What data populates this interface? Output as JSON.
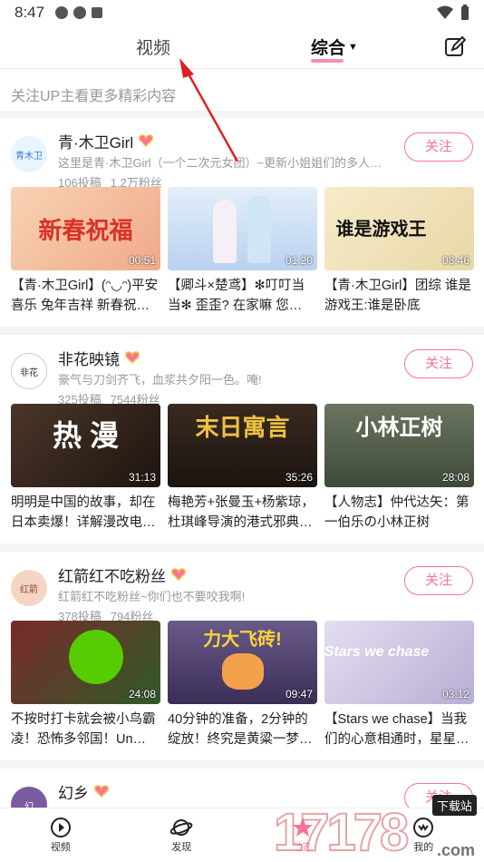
{
  "status_bar": {
    "time": "8:47"
  },
  "top_tabs": {
    "video": "视频",
    "sort": "综合"
  },
  "hint": "关注UP主看更多精彩内容",
  "ups": [
    {
      "name": "青·木卫Girl",
      "avatar_text": "青木卫",
      "avatar_color": "#e8f4ff",
      "sign": "这里是青·木卫Girl（一个二次元女团）~更新小姐姐们的多人…",
      "posts": "106投稿",
      "fans": "1.2万粉丝",
      "follow": "关注",
      "videos": [
        {
          "title": "【青·木卫Girl】(ᵔ◡ᵔ)平安喜乐 兔年吉祥 新春祝…",
          "duration": "00:51",
          "thumb_text": "新春祝福",
          "thumb_bg": "#f6c9a8"
        },
        {
          "title": "【卿斗×楚鸢】✻叮叮当当✻ 歪歪? 在家嘛 您…",
          "duration": "01:20",
          "thumb_text": "",
          "thumb_bg": "#cfe3f7"
        },
        {
          "title": "【青·木卫Girl】团综 谁是游戏王:谁是卧底",
          "duration": "08:46",
          "thumb_text": "谁是游戏王",
          "thumb_bg": "#f2e6c2"
        }
      ]
    },
    {
      "name": "非花映镜",
      "avatar_text": "非花",
      "avatar_color": "#3a4a5a",
      "sign": "豪气与刀剑齐飞，血浆共夕阳一色。唵!",
      "posts": "325投稿",
      "fans": "7544粉丝",
      "follow": "关注",
      "videos": [
        {
          "title": "明明是中国的故事，却在日本卖爆！详解漫改电…",
          "duration": "31:13",
          "thumb_text": "热 漫",
          "thumb_bg": "#3b2b22"
        },
        {
          "title": "梅艳芳+张曼玉+杨紫琼，杜琪峰导演的港式邪典…",
          "duration": "35:26",
          "thumb_text": "末日寓言",
          "thumb_bg": "#2a1f1a"
        },
        {
          "title": "【人物志】仲代达矢：第一伯乐の小林正树",
          "duration": "28:08",
          "thumb_text": "小林正树",
          "thumb_bg": "#556050"
        }
      ]
    },
    {
      "name": "红箭红不吃粉丝",
      "avatar_text": "红箭",
      "avatar_color": "#f5d6c4",
      "sign": "红箭红不吃粉丝~你们也不要咬我啊!",
      "posts": "378投稿",
      "fans": "794粉丝",
      "follow": "关注",
      "videos": [
        {
          "title": "不按时打卡就会被小鸟霸凌！恐怖多邻国！Un…",
          "duration": "24:08",
          "thumb_text": "",
          "thumb_bg": "#2f3a2a"
        },
        {
          "title": "40分钟的准备，2分钟的绽放！终究是黄粱一梦…",
          "duration": "09:47",
          "thumb_text": "力大飞砖!",
          "thumb_bg": "#5a4a7a"
        },
        {
          "title": "【Stars we chase】当我们的心意相通时，星星…",
          "duration": "03:12",
          "thumb_text": "Stars we chase",
          "thumb_bg": "#d9d2ea"
        }
      ]
    },
    {
      "name": "幻乡",
      "avatar_text": "幻",
      "avatar_color": "#7a5aa0",
      "follow": "关注"
    }
  ],
  "bottom_nav": {
    "video": "视频",
    "discover": "发现",
    "dynamic": "动态",
    "mine": "我的"
  },
  "watermark": {
    "big": "17178",
    "tag": "下载站",
    "domain": ".com"
  }
}
